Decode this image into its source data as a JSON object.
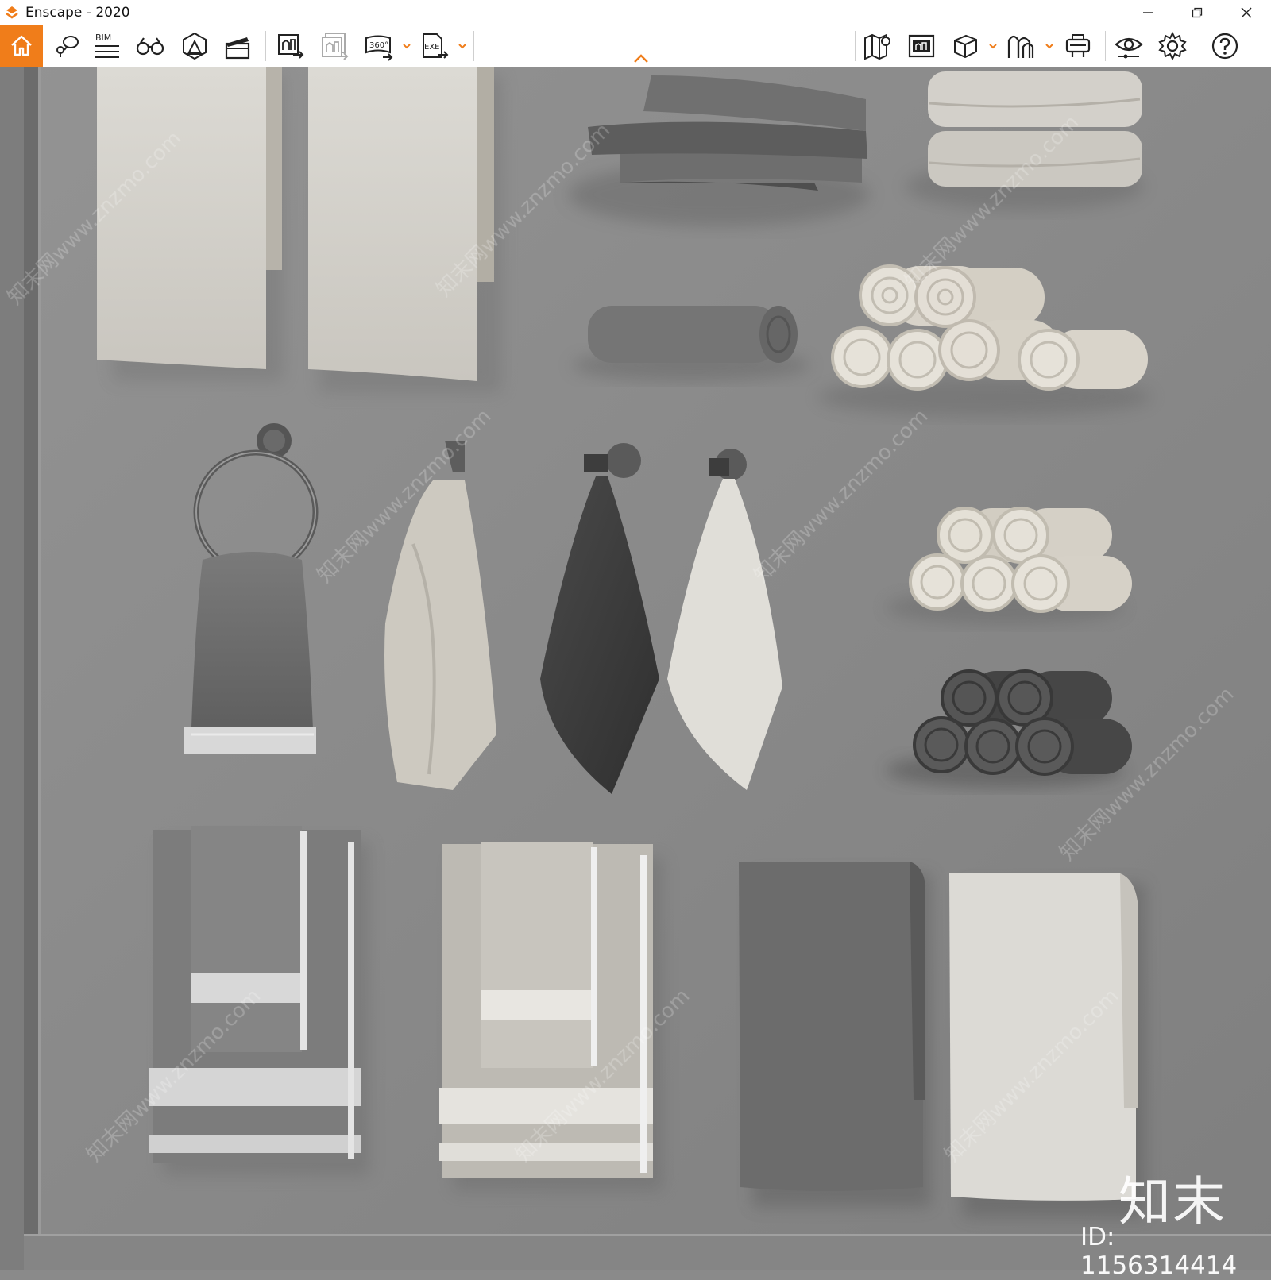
{
  "window": {
    "title": "Enscape - 2020",
    "controls": [
      "minimize",
      "restore",
      "close"
    ]
  },
  "toolbar": {
    "accent_color": "#f07d1a",
    "bim_label": "BIM",
    "buttons": [
      {
        "name": "home-icon",
        "active": true
      },
      {
        "name": "map-pin-view-icon"
      },
      {
        "name": "bim-icon"
      },
      {
        "name": "binoculars-icon"
      },
      {
        "name": "atmosphere-icon"
      },
      {
        "name": "video-editor-icon"
      },
      {
        "name": "render-image-icon"
      },
      {
        "name": "batch-render-icon"
      },
      {
        "name": "panorama-360-icon",
        "label": "360°"
      },
      {
        "name": "export-exe-icon",
        "label": "EXE"
      },
      {
        "name": "minimap-icon"
      },
      {
        "name": "asset-library-icon"
      },
      {
        "name": "section-box-icon"
      },
      {
        "name": "material-editor-icon"
      },
      {
        "name": "vr-headset-icon"
      },
      {
        "name": "visual-settings-icon"
      },
      {
        "name": "settings-gear-icon"
      },
      {
        "name": "help-icon"
      }
    ]
  },
  "watermark": {
    "brand": "知末",
    "id": "ID: 1156314414",
    "tile_text": "知末网www.znzmo.com"
  }
}
